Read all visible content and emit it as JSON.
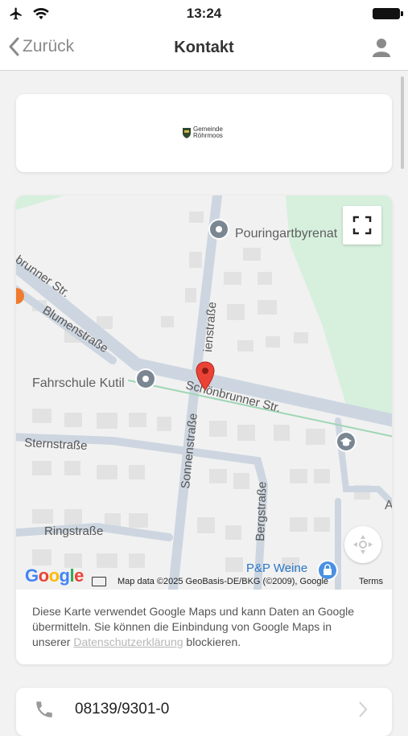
{
  "status_bar": {
    "time": "13:24"
  },
  "nav": {
    "back_label": "Zurück",
    "title": "Kontakt"
  },
  "logo": {
    "line1": "Gemeinde",
    "line2": "Röhrmoos"
  },
  "map": {
    "streets": {
      "schoenbrunner_left": "brunner Str.",
      "blumen": "Blumenstraße",
      "schoenbrunner_main": "Schönbrunner Str.",
      "sonnen": "Sonnenstraße",
      "sonnen_top": "ienstraße",
      "stern": "Sternstraße",
      "ring": "Ringstraße",
      "berg": "Bergstraße"
    },
    "pois": {
      "pouring": "Pouringartbyrenat",
      "fahrschule": "Fahrschule Kutil",
      "pp": "P&P Weine",
      "edge_a": "A"
    },
    "attribution": "Map data ©2025 GeoBasis-DE/BKG (©2009), Google",
    "terms": "Terms",
    "google_logo": [
      "G",
      "o",
      "o",
      "g",
      "l",
      "e"
    ]
  },
  "map_note": {
    "text_before": "Diese Karte verwendet Google Maps und kann Daten an Google übermitteln. Sie können die Einbindung von Google Maps in unserer ",
    "link": "Datenschutzerklärung",
    "text_after": " blockieren."
  },
  "contact": {
    "phone": "08139/9301-0"
  },
  "colors": {
    "accent_grey": "#8a8a8a",
    "park_green": "#d6f0dd",
    "pin_red": "#ea4335"
  }
}
